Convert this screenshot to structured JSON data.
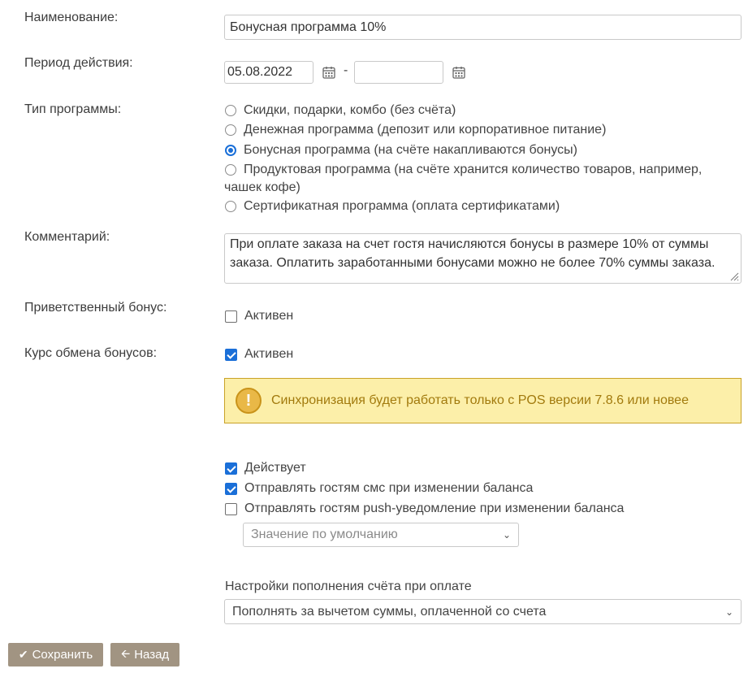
{
  "labels": {
    "name": "Наименование:",
    "period": "Период действия:",
    "type": "Тип программы:",
    "comment": "Комментарий:",
    "welcome_bonus": "Приветственный бонус:",
    "exchange_rate": "Курс обмена бонусов:"
  },
  "name_value": "Бонусная программа 10%",
  "period": {
    "from": "05.08.2022",
    "separator": "-",
    "to": ""
  },
  "program_types": [
    {
      "label": "Скидки, подарки, комбо (без счёта)",
      "selected": false
    },
    {
      "label": "Денежная программа (депозит или корпоративное питание)",
      "selected": false
    },
    {
      "label": "Бонусная программа (на счёте накапливаются бонусы)",
      "selected": true
    },
    {
      "label": "Продуктовая программа (на счёте хранится количество товаров, например,",
      "label_cont": "чашек кофе)",
      "selected": false
    },
    {
      "label": "Сертификатная программа (оплата сертификатами)",
      "selected": false
    }
  ],
  "comment": {
    "line1": "При оплате заказа на счет гостя начисляются бонусы в размере 10% от суммы",
    "line2": "заказа. Оплатить заработанными бонусами можно не более 70% суммы заказа."
  },
  "welcome_bonus": {
    "label": "Активен",
    "checked": false
  },
  "exchange_rate": {
    "label": "Активен",
    "checked": true
  },
  "alert": {
    "icon": "!",
    "text": "Синхронизация будет работать только с POS версии 7.8.6 или новее"
  },
  "options": [
    {
      "label": "Действует",
      "checked": true
    },
    {
      "label": "Отправлять гостям смс при изменении баланса",
      "checked": true
    },
    {
      "label": "Отправлять гостям push-уведомление при изменении баланса",
      "checked": false
    }
  ],
  "push_select": {
    "value": "Значение по умолчанию"
  },
  "topup": {
    "title": "Настройки пополнения счёта при оплате",
    "value": "Пополнять за вычетом суммы, оплаченной со счета"
  },
  "buttons": {
    "save": "Сохранить",
    "back": "Назад"
  },
  "colors": {
    "accent": "#1a6fd8",
    "button": "#a19482",
    "alert_bg": "#fcefa9",
    "alert_text": "#a27a0d"
  }
}
